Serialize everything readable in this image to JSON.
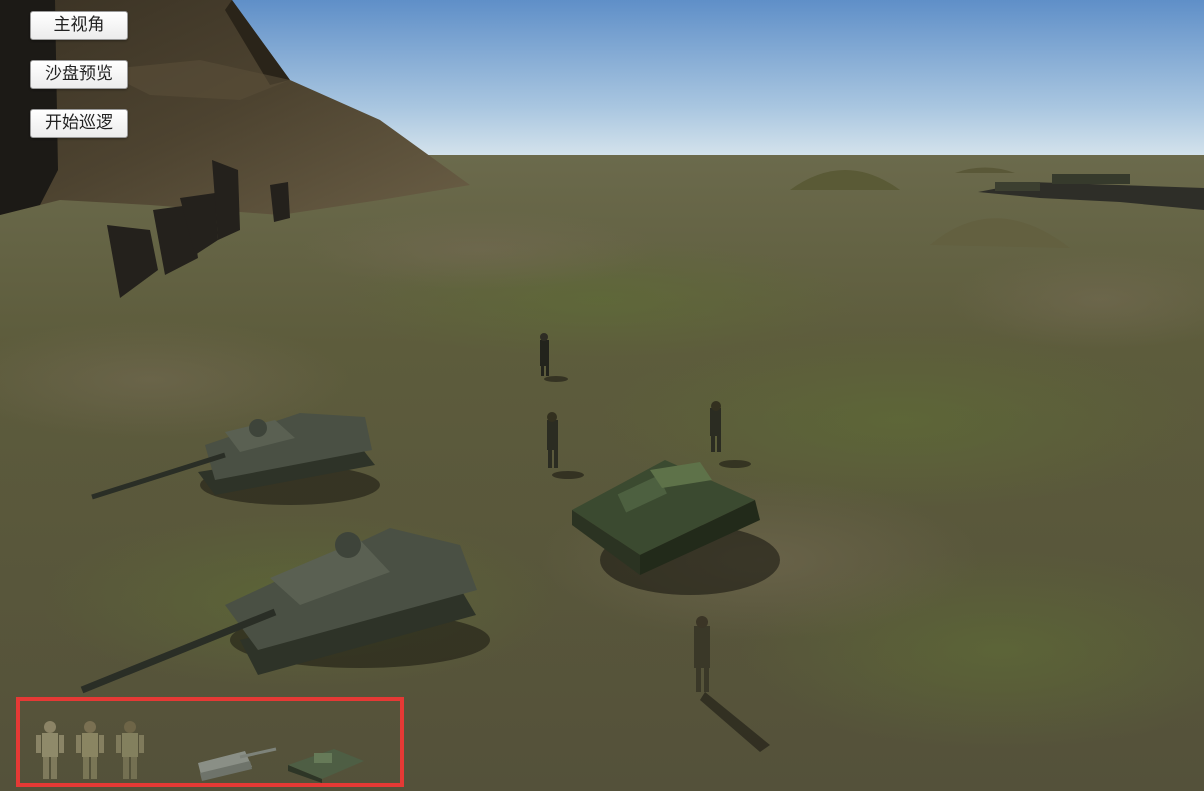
{
  "menu": {
    "main_view": "主视角",
    "sandtable_preview": "沙盘预览",
    "start_patrol": "开始巡逻"
  },
  "palette": {
    "highlight_color": "#e53935",
    "items": [
      "soldier-icon",
      "soldier-icon",
      "soldier-icon",
      "tank-destroyer-icon",
      "heavy-tank-icon"
    ]
  },
  "colors": {
    "sky_top": "#5f8fc8",
    "sky_horizon": "#d8e6ef",
    "terrain": "#5c5a3a",
    "accent_frame": "#e53935"
  }
}
